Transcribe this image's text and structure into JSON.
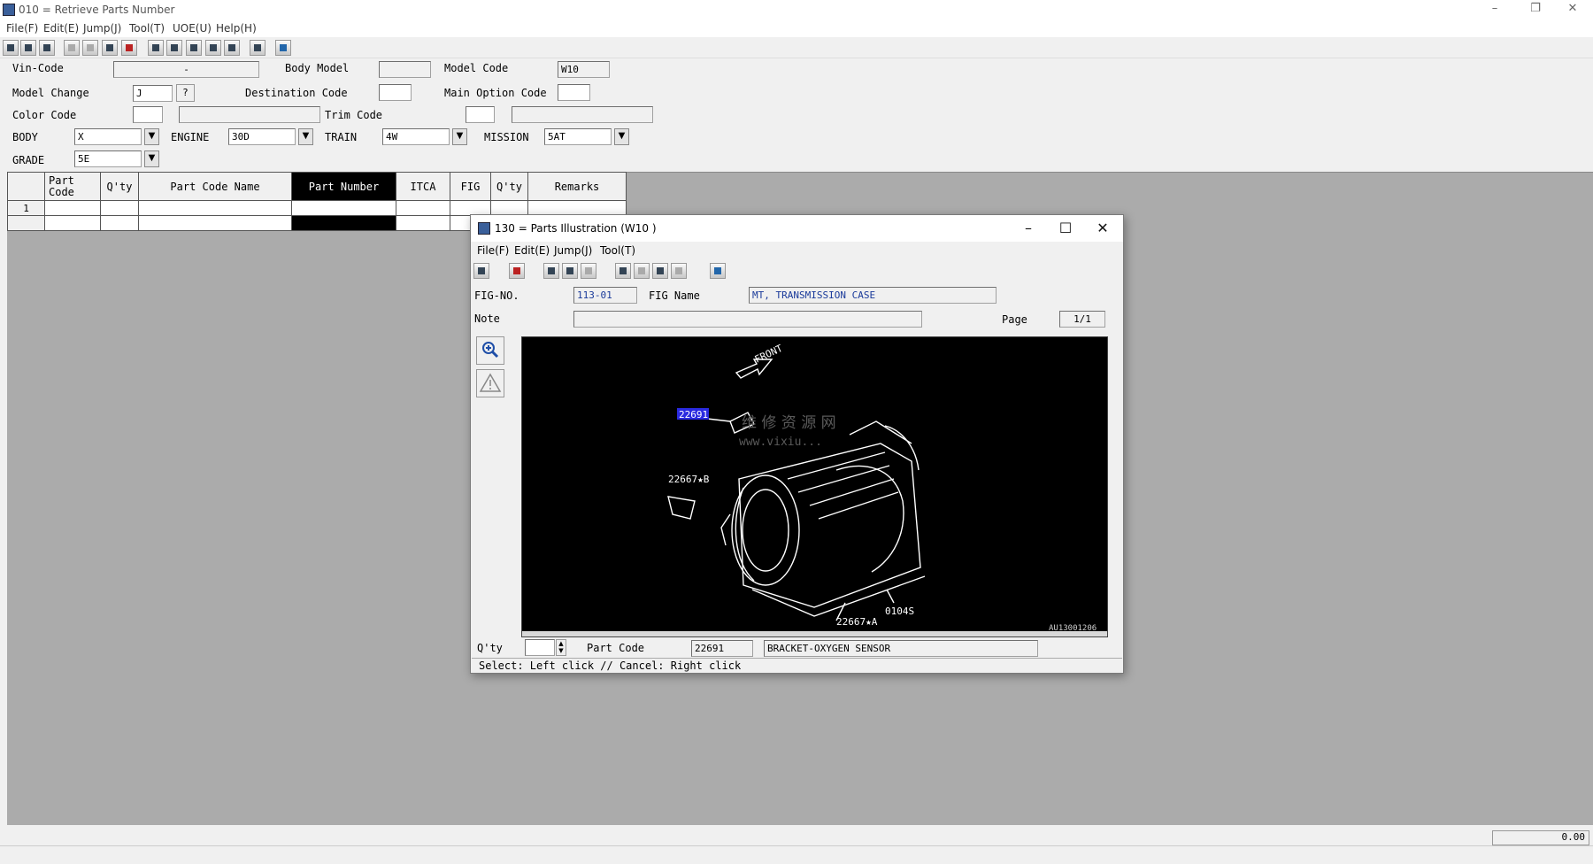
{
  "window": {
    "title": "010 = Retrieve Parts Number"
  },
  "menu": [
    "File(F)",
    "Edit(E)",
    "Jump(J)",
    "Tool(T)",
    "UOE(U)",
    "Help(H)"
  ],
  "form": {
    "vin_code": {
      "label": "Vin-Code",
      "value": "-"
    },
    "body_model": {
      "label": "Body Model",
      "value": ""
    },
    "model_code": {
      "label": "Model Code",
      "value": "W10"
    },
    "model_change": {
      "label": "Model Change",
      "value": "J",
      "help": "?"
    },
    "destination_code": {
      "label": "Destination Code",
      "value": ""
    },
    "main_option_code": {
      "label": "Main Option Code",
      "value": ""
    },
    "color_code": {
      "label": "Color Code",
      "value": ""
    },
    "trim_code": {
      "label": "Trim Code",
      "value": ""
    },
    "body": {
      "label": "BODY",
      "value": "X"
    },
    "engine": {
      "label": "ENGINE",
      "value": "30D"
    },
    "train": {
      "label": "TRAIN",
      "value": "4W"
    },
    "mission": {
      "label": "MISSION",
      "value": "5AT"
    },
    "grade": {
      "label": "GRADE",
      "value": "5E"
    },
    "dropdown_glyph": "▼"
  },
  "grid": {
    "headers": [
      "Part Code",
      "Q'ty",
      "Part Code Name",
      "Part Number",
      "ITCA",
      "FIG",
      "Q'ty",
      "Remarks"
    ],
    "rows": [
      "1"
    ]
  },
  "status": {
    "value": "0.00"
  },
  "child": {
    "title": "130 = Parts Illustration (W10  )",
    "menu": [
      "File(F)",
      "Edit(E)",
      "Jump(J)",
      "Tool(T)"
    ],
    "fig_no": {
      "label": "FIG-NO.",
      "value": "113-01"
    },
    "fig_name": {
      "label": "FIG Name",
      "value": "MT, TRANSMISSION CASE"
    },
    "note": {
      "label": "Note",
      "value": ""
    },
    "page": {
      "label": "Page",
      "value": "1/1"
    },
    "illustration": {
      "front_label": "FRONT",
      "callouts": [
        "22691",
        "22667★B",
        "22667★A",
        "0104S"
      ],
      "selected_callout": "22691",
      "watermark_cn": "维 修 资 源 网",
      "watermark_url": "www.vixiu...",
      "image_id": "AU13001206"
    },
    "qty": {
      "label": "Q'ty",
      "value": ""
    },
    "part_code": {
      "label": "Part Code",
      "value": "22691",
      "name": "BRACKET-OXYGEN SENSOR"
    },
    "status_text": "Select: Left click // Cancel: Right click"
  }
}
